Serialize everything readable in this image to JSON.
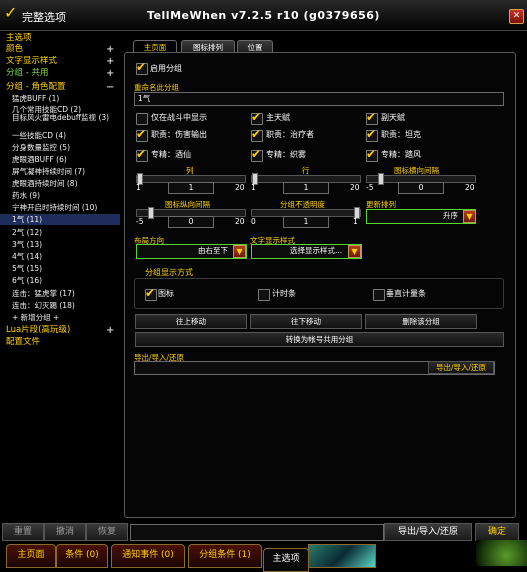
{
  "window": {
    "title": "完整选项",
    "app_title": "TellMeWhen v7.2.5 r10 (g0379656)",
    "close": "✕"
  },
  "nav": {
    "main_options": "主选项",
    "color": "颜色",
    "text_display": "文字显示样式",
    "group_shared": "分组 - 共用",
    "group_role": "分组 - 角色配置",
    "items": [
      "猛虎BUFF (1)",
      "几个常用技能CD (2)",
      "目标风火雷电debuff监视 (3)",
      "一些技能CD (4)",
      "分身数量监控 (5)",
      "虎眼酒BUFF (6)",
      "屏气凝神持续时间 (7)",
      "虎眼酒持续时间 (8)",
      "药水 (9)",
      "宁神开启时持续时间 (10)",
      "1气 (11)",
      "2气 (12)",
      "3气 (13)",
      "4气 (14)",
      "5气 (15)",
      "6气 (16)",
      "连击：猛虎掌 (17)",
      "连击：幻灭踢 (18)"
    ],
    "new_group": "+ 新增分组 +",
    "lua_snippets": "Lua片段(高玩级)",
    "profiles": "配置文件"
  },
  "tabs": [
    "主页面",
    "图标排列",
    "位置"
  ],
  "panel": {
    "enable_group": "启用分组",
    "rename_label": "重命名此分组",
    "group_name": "1气",
    "combat_only": "仅在战斗中显示",
    "primary_spec": "主天赋",
    "secondary_spec": "副天赋",
    "role_dps": "职责：伤害输出",
    "role_heal": "职责：治疗者",
    "role_tank": "职责：坦克",
    "spec_brewmaster": "专精：酒仙",
    "spec_mistweaver": "专精：织雾",
    "spec_windwalker": "专精：踏风",
    "columns": {
      "label": "列",
      "value": "1",
      "min": "1",
      "max": "20"
    },
    "rows": {
      "label": "行",
      "value": "1",
      "min": "1",
      "max": "20"
    },
    "h_spacing": {
      "label": "图标横向间隔",
      "value": "0",
      "min": "-5",
      "max": "20"
    },
    "v_spacing": {
      "label": "图标纵向间隔",
      "value": "0",
      "min": "-5",
      "max": "20"
    },
    "opacity": {
      "label": "分组不透明度",
      "value": "1",
      "min": "0",
      "max": "1"
    },
    "sort_label": "更新排列",
    "sort_value": "升序",
    "layout_dir_label": "布局方向",
    "layout_dir_value": "由右至下",
    "text_style_label": "文字显示样式",
    "text_style_value": "选择显示样式...",
    "display_method": "分组显示方式",
    "mode_icon": "图标",
    "mode_timer": "计时条",
    "mode_vbar": "垂直计量条",
    "move_up": "往上移动",
    "move_down": "往下移动",
    "delete_group": "删除该分组",
    "convert_shared": "转换为帐号共用分组",
    "import_export_label": "导出/导入/还原",
    "import_export_btn": "导出/导入/还原"
  },
  "bottom": {
    "reset": "重置",
    "undo": "撤消",
    "redo": "恢复",
    "import_export": "导出/导入/还原",
    "ok": "确定"
  },
  "bottom_tabs": [
    "主页面",
    "条件 (0)",
    "通知事件 (0)",
    "分组条件 (1)",
    "主选项"
  ],
  "colors": {
    "accent": "#ffd200",
    "highlight": "#59d62b",
    "selected": "#1f2d5c"
  }
}
